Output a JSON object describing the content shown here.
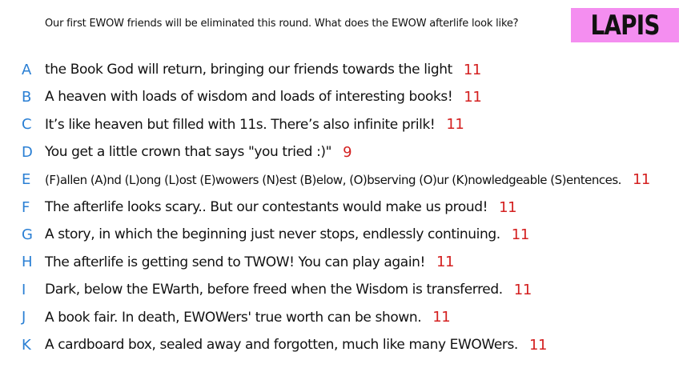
{
  "prompt": "Our first EWOW friends will be eliminated this round. What does the EWOW afterlife look like?",
  "badge": "LAPIS",
  "colors": {
    "badge_bg": "#f48ef0",
    "letter": "#2a7fd4",
    "score": "#d42020"
  },
  "responses": [
    {
      "letter": "A",
      "text": "the Book God will return, bringing our friends towards the light",
      "score": "11"
    },
    {
      "letter": "B",
      "text": "A heaven with loads of wisdom and loads of interesting books!",
      "score": "11"
    },
    {
      "letter": "C",
      "text": "It’s like heaven but filled with 11s. There’s also infinite prilk!",
      "score": "11"
    },
    {
      "letter": "D",
      "text": "You get a little crown that says \"you tried :)\"",
      "score": "9"
    },
    {
      "letter": "E",
      "text": "(F)allen (A)nd (L)ong (L)ost (E)wowers (N)est (B)elow, (O)bserving (O)ur (K)nowledgeable (S)entences.",
      "score": "11"
    },
    {
      "letter": "F",
      "text": "The afterlife looks scary.. But our contestants would make us proud!",
      "score": "11"
    },
    {
      "letter": "G",
      "text": "A story, in which the beginning just never stops, endlessly continuing.",
      "score": "11"
    },
    {
      "letter": "H",
      "text": "The afterlife is getting send to TWOW! You can play again!",
      "score": "11"
    },
    {
      "letter": "I",
      "text": "Dark, below the EWarth, before freed when the Wisdom is transferred.",
      "score": "11"
    },
    {
      "letter": "J",
      "text": "A book fair. In death, EWOWers' true worth can be shown.",
      "score": "11"
    },
    {
      "letter": "K",
      "text": "A cardboard box, sealed away and forgotten, much like many EWOWers.",
      "score": "11"
    }
  ]
}
